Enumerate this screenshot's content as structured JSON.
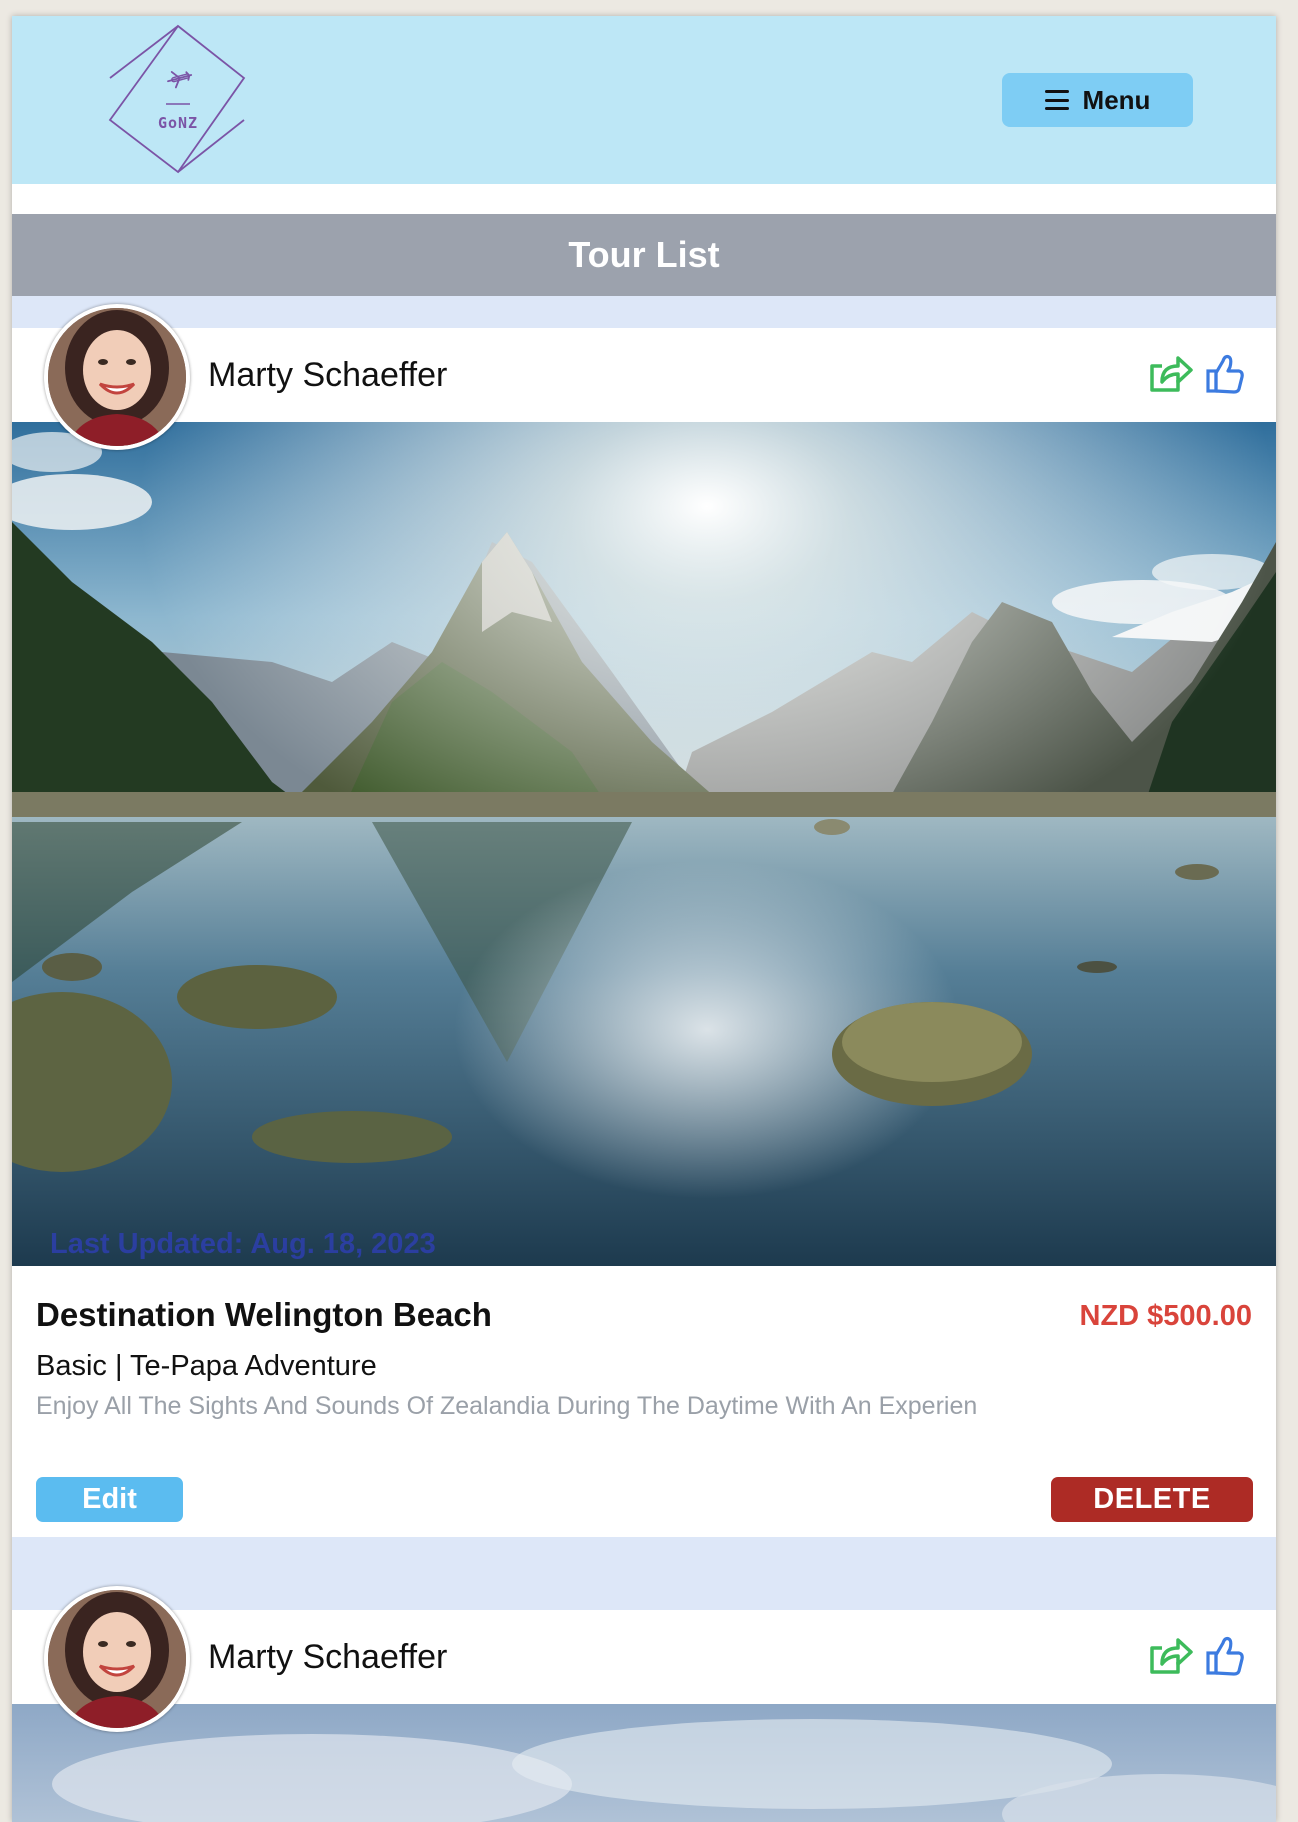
{
  "header": {
    "logo_text": "GoNZ",
    "menu_label": "Menu"
  },
  "page": {
    "title": "Tour List"
  },
  "tours": [
    {
      "author": "Marty Schaeffer",
      "last_updated": "Last Updated: Aug. 18, 2023",
      "title": "Destination Welington Beach",
      "price": "NZD $500.00",
      "subtitle": "Basic | Te-Papa Adventure",
      "description": "Enjoy All The Sights And Sounds Of Zealandia During The Daytime With An Experien",
      "edit_label": "Edit",
      "delete_label": "DELETE"
    },
    {
      "author": "Marty Schaeffer"
    }
  ],
  "icons": {
    "logo": "airplane-icon",
    "menu": "hamburger-icon",
    "share": "share-icon",
    "like": "thumbs-up-icon"
  },
  "colors": {
    "header_bg": "#bde7f6",
    "menu_button": "#7ecdf4",
    "titlebar": "#9ca2ad",
    "page_bg": "#dde7f8",
    "price": "#d9443b",
    "edit_button": "#5bbcf0",
    "delete_button": "#ad2b25",
    "updated_text": "#2d3fae",
    "share_icon": "#3dbb5b",
    "like_icon": "#3c7be0"
  }
}
